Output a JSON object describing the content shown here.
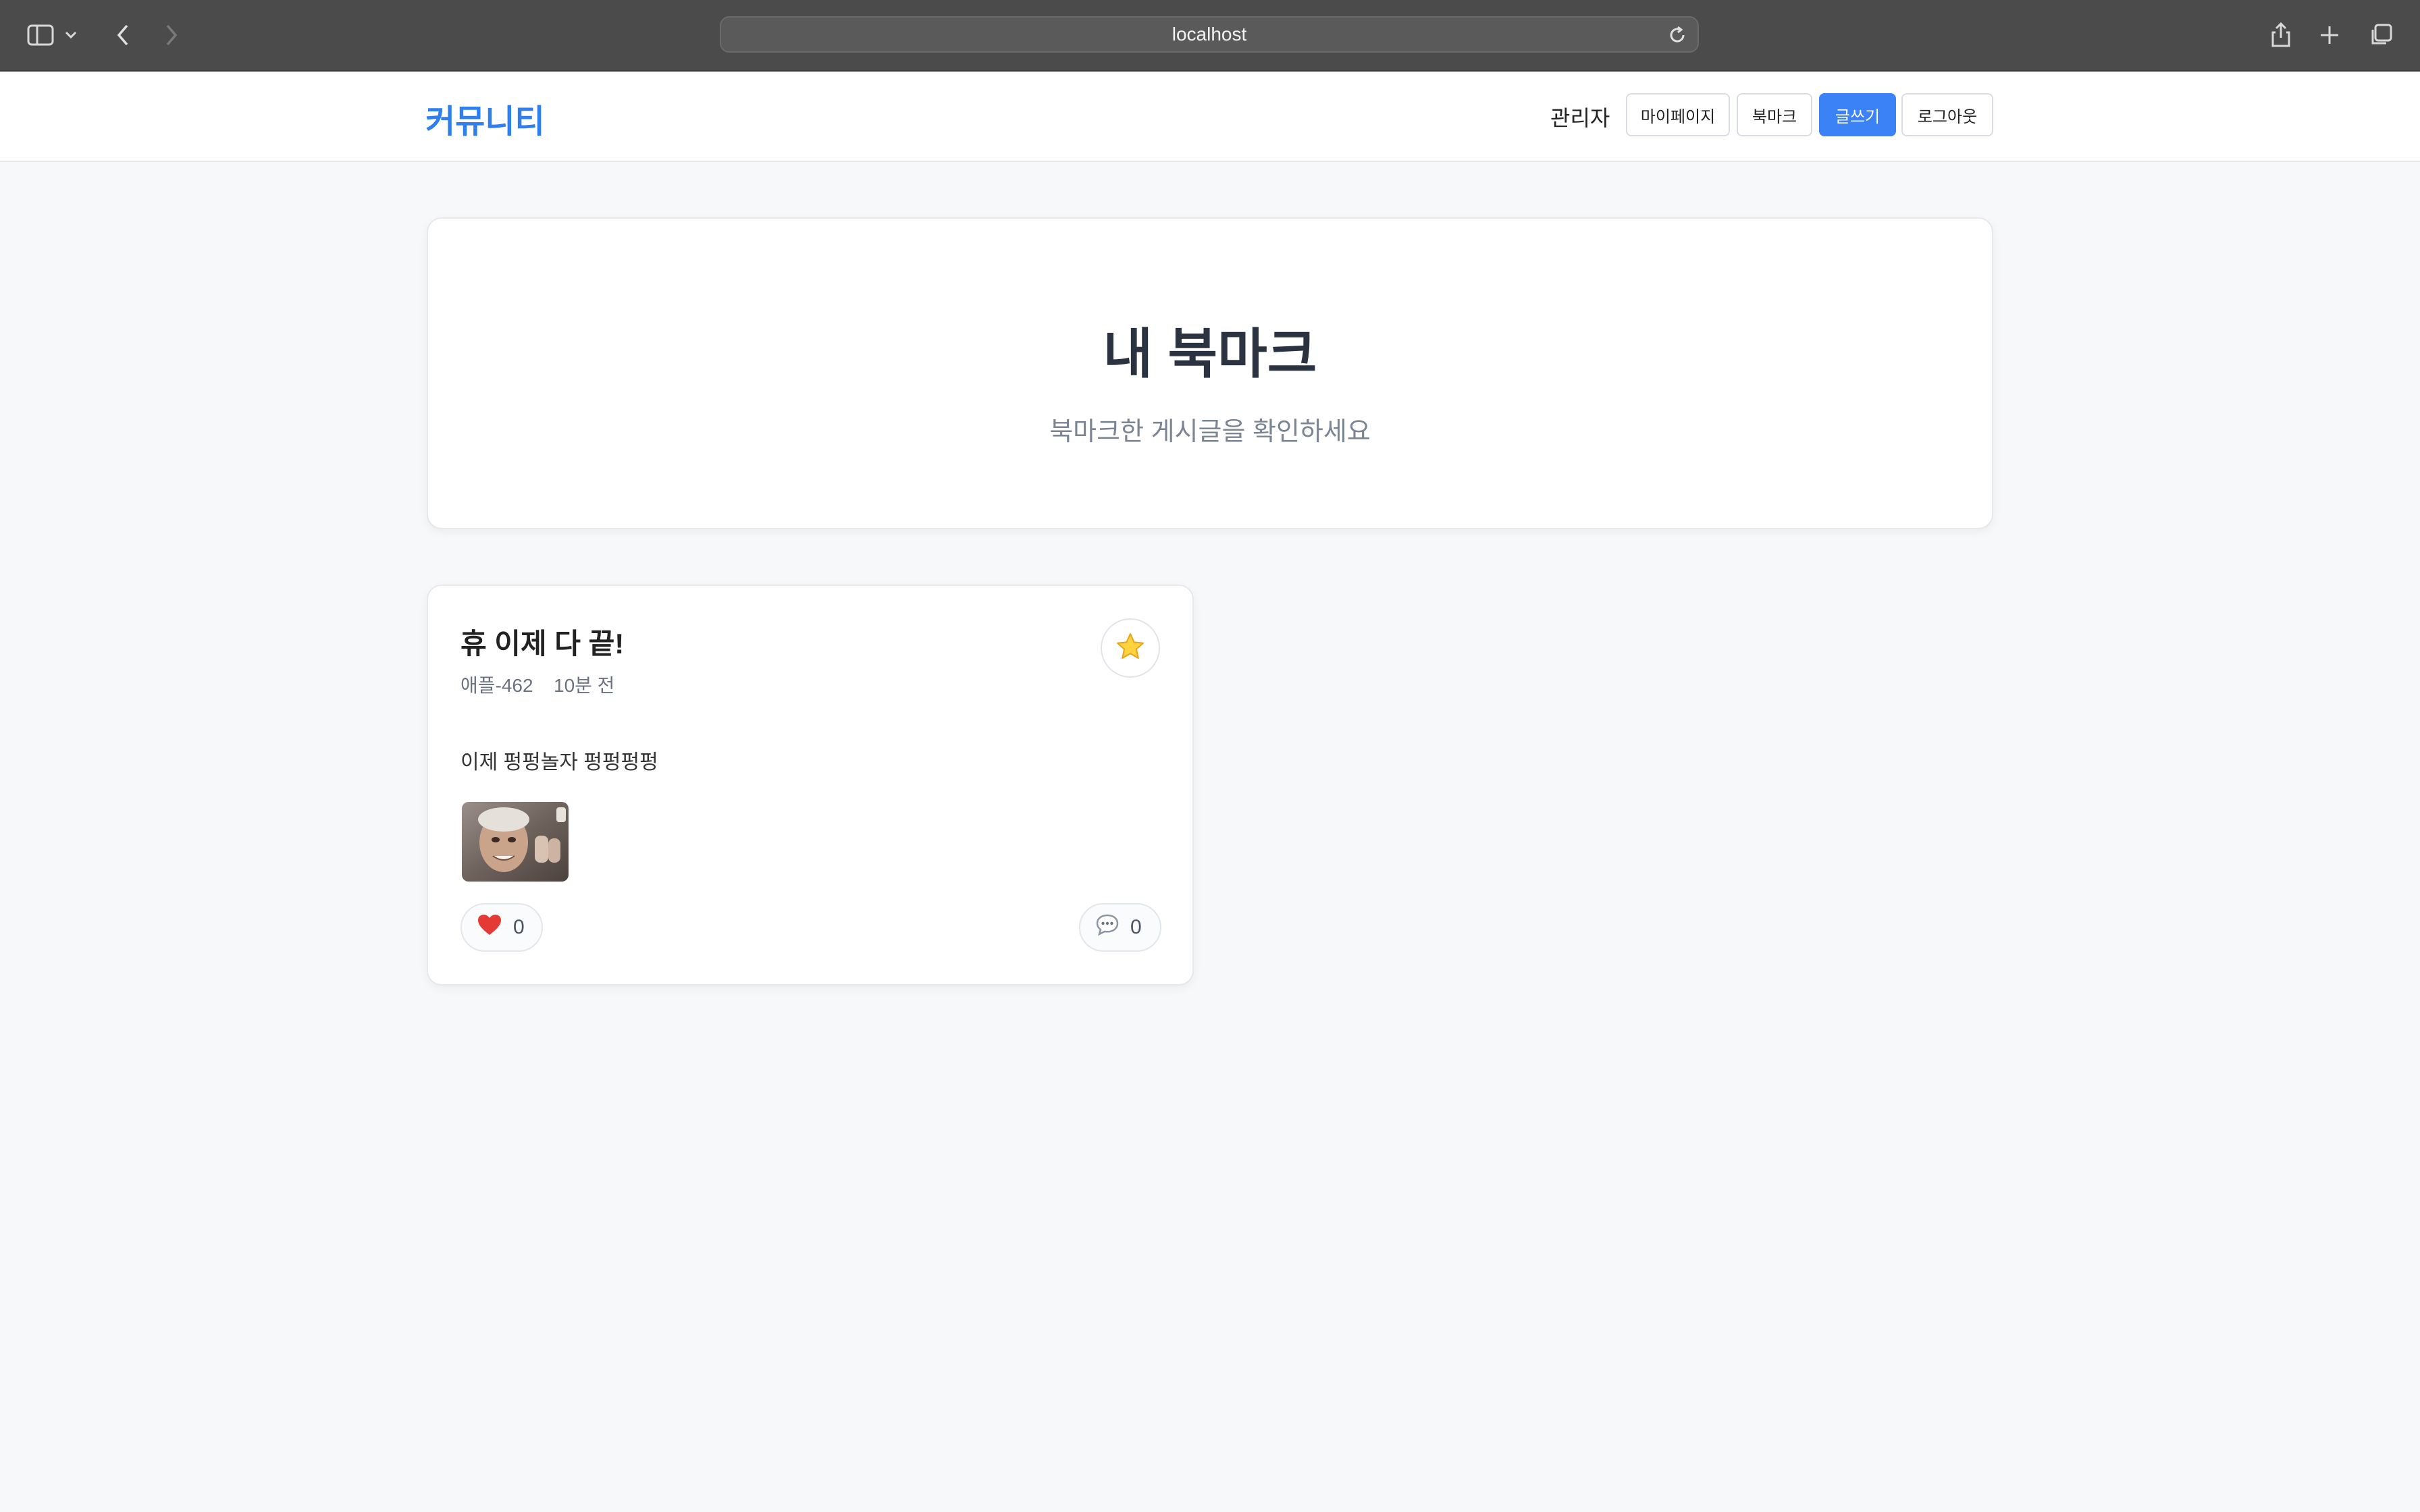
{
  "browser": {
    "url": "localhost",
    "icons": [
      "sidebar-icon",
      "chevron-down-icon",
      "back-icon",
      "forward-icon",
      "reload-icon",
      "share-icon",
      "plus-icon",
      "tabs-icon"
    ]
  },
  "header": {
    "logo": "커뮤니티",
    "username": "관리자",
    "buttons": {
      "mypage": "마이페이지",
      "bookmark": "북마크",
      "write": "글쓰기",
      "logout": "로그아웃"
    }
  },
  "hero": {
    "title": "내 북마크",
    "subtitle": "북마크한 게시글을 확인하세요"
  },
  "posts": [
    {
      "title": "휴 이제 다 끝!",
      "author": "애플-462",
      "time": "10분 전",
      "content": "이제 펑펑놀자 펑펑펑펑",
      "likes": "0",
      "comments": "0",
      "bookmarked": true
    }
  ],
  "colors": {
    "accent": "#3b82f6",
    "logo": "#2f80ed",
    "background": "#f7f8fa"
  }
}
